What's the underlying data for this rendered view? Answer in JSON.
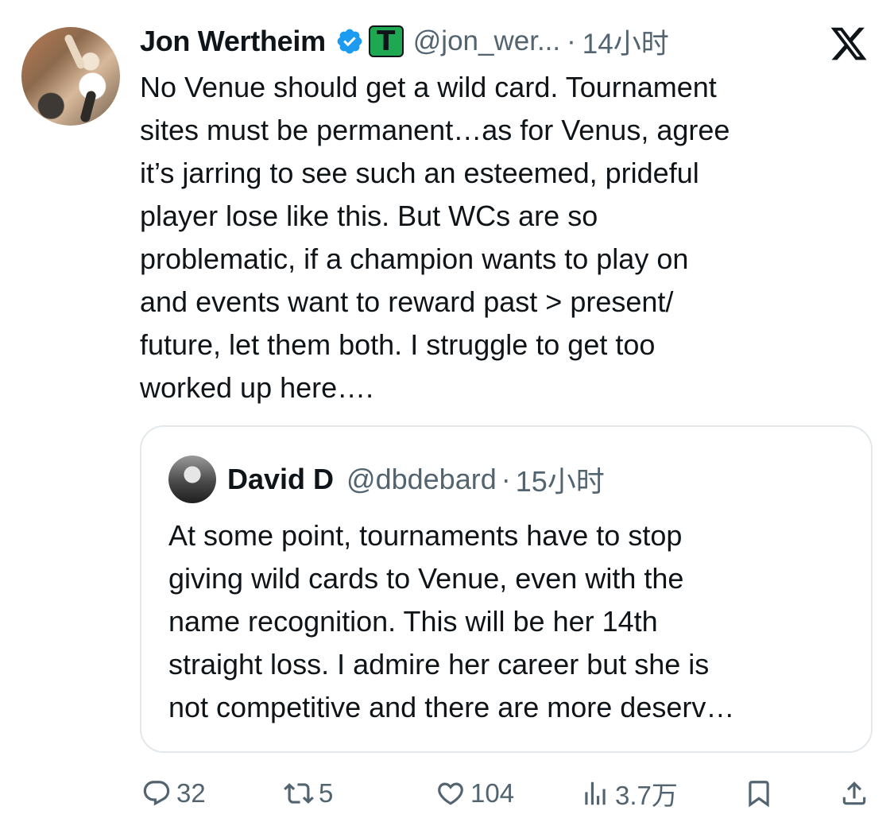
{
  "author": {
    "name": "Jon Wertheim",
    "handle": "@jon_wer...",
    "separator": "·",
    "time": "14小时",
    "affiliate_letter": "T"
  },
  "tweet_text": "No Venue should get a wild card. Tournament\nsites must be permanent…as for Venus, agree\nit’s jarring to see such an esteemed, prideful\nplayer lose like this. But WCs are so\nproblematic, if a champion wants to play on\nand events want to reward past > present/\nfuture, let them both. I struggle to get too\nworked up here….",
  "quote": {
    "name": "David D",
    "handle": "@dbdebard",
    "separator": "·",
    "time": "15小时",
    "text": "At some point, tournaments have to stop\ngiving wild cards to Venue, even with the\nname recognition.  This will be her 14th\nstraight loss.  I admire her career but she is\nnot competitive and there are more deserv…"
  },
  "actions": {
    "replies": "32",
    "reposts": "5",
    "likes": "104",
    "views": "3.7万"
  },
  "colors": {
    "text": "#0f1419",
    "secondary": "#536471",
    "verified": "#1d9bf0",
    "affiliate": "#1da851",
    "border": "#e3e8ec"
  },
  "icons": [
    "verified-badge-icon",
    "affiliate-badge-icon",
    "x-logo-icon",
    "reply-icon",
    "repost-icon",
    "like-icon",
    "views-icon",
    "bookmark-icon",
    "share-icon"
  ]
}
